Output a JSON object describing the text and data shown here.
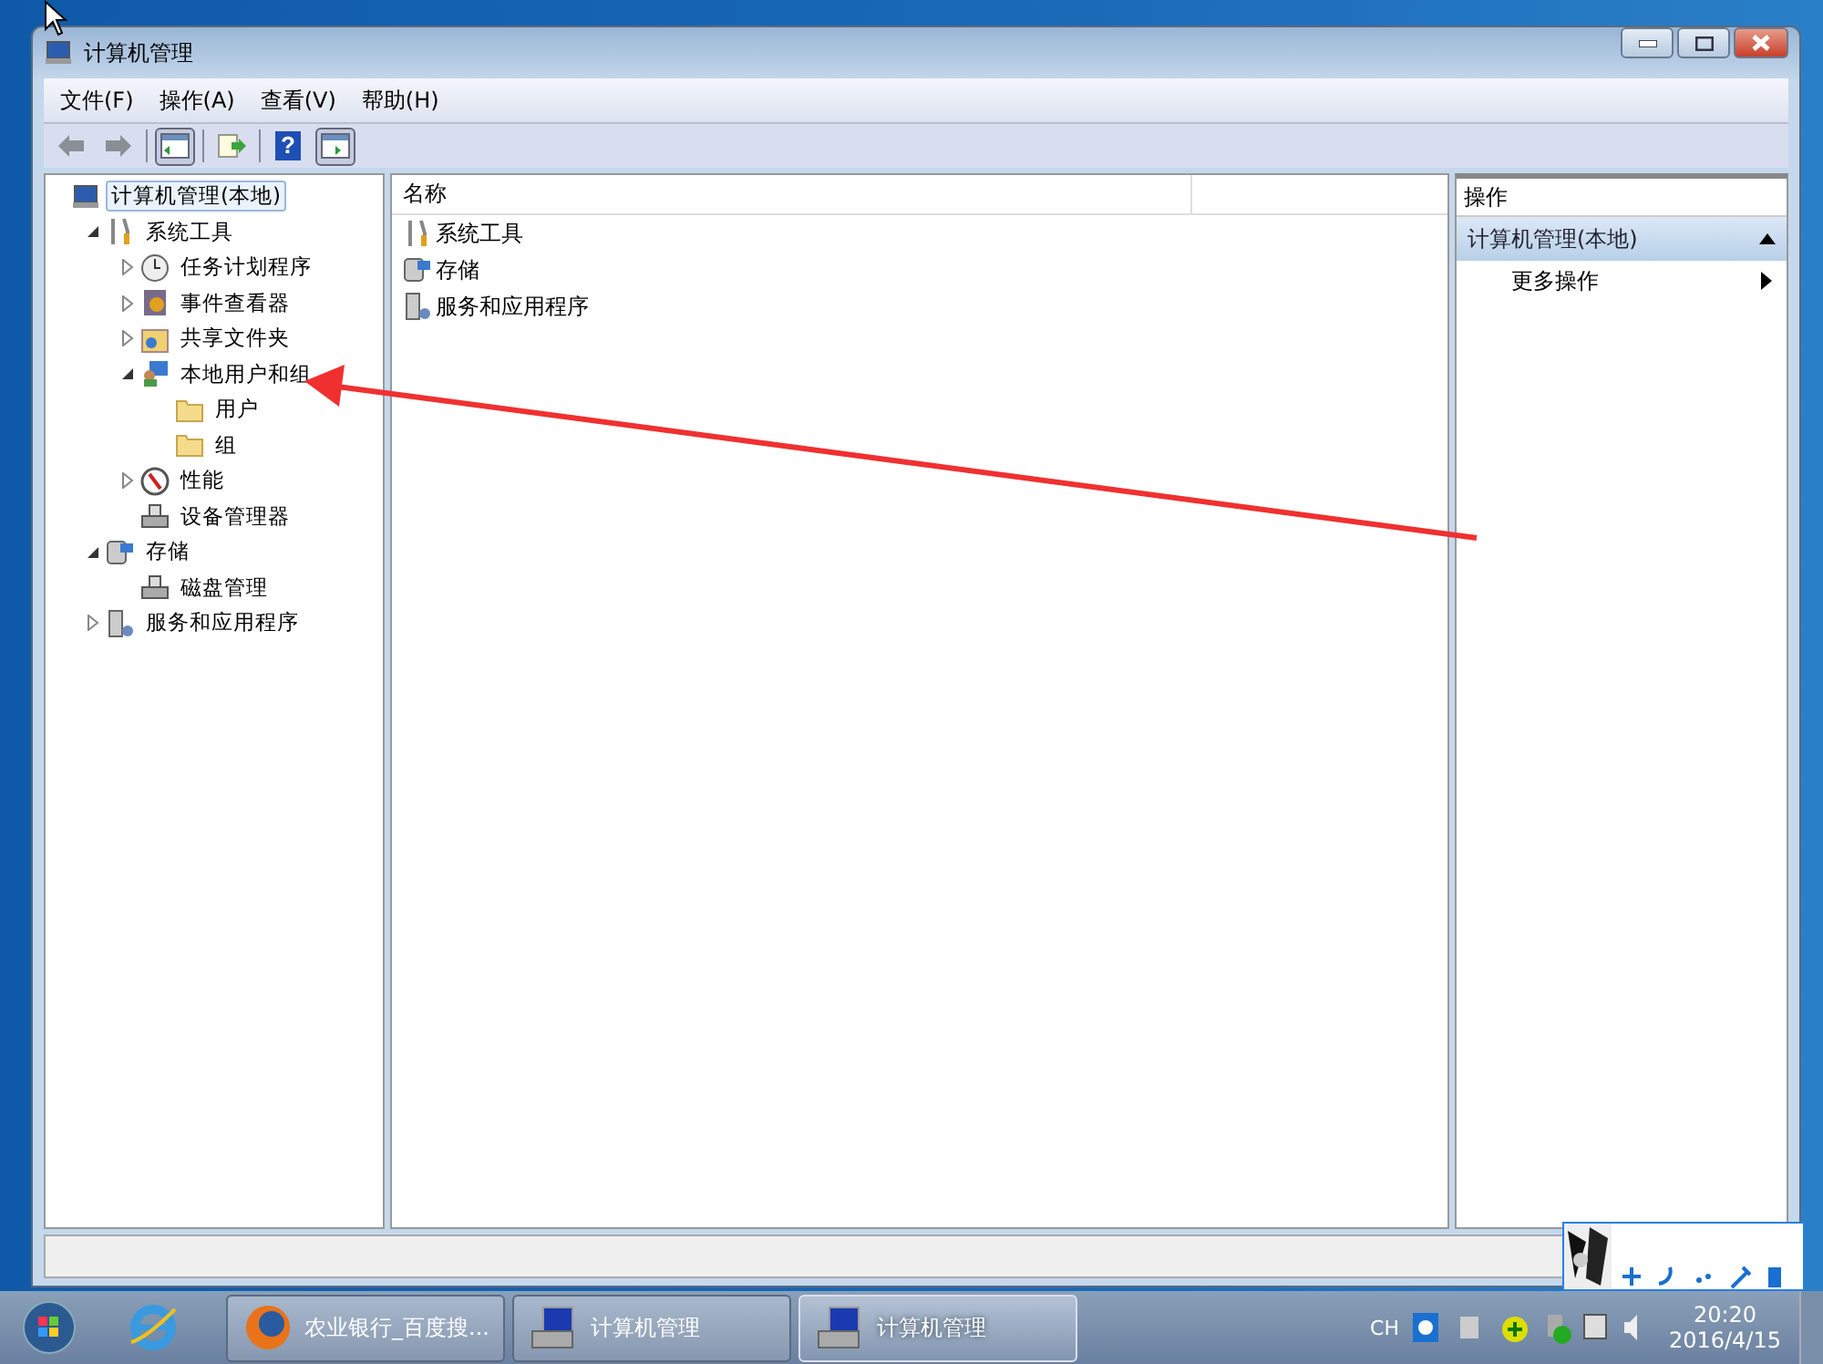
{
  "window": {
    "title": "计算机管理"
  },
  "menu": [
    "文件(F)",
    "操作(A)",
    "查看(V)",
    "帮助(H)"
  ],
  "toolbar": [
    {
      "kind": "back",
      "pressed": false
    },
    {
      "kind": "forward",
      "pressed": false
    },
    {
      "kind": "sep"
    },
    {
      "kind": "tree",
      "pressed": true
    },
    {
      "kind": "sep"
    },
    {
      "kind": "export",
      "pressed": false
    },
    {
      "kind": "sep"
    },
    {
      "kind": "help",
      "label": "?",
      "pressed": false
    },
    {
      "kind": "actionpane",
      "pressed": true
    }
  ],
  "tree": [
    {
      "label": "计算机管理(本地)",
      "kind": "computer",
      "selected": true,
      "children": [
        {
          "label": "系统工具",
          "kind": "tools",
          "selected": false,
          "expanded": true,
          "children": [
            {
              "label": "任务计划程序",
              "kind": "clock",
              "selected": false,
              "expanded": false
            },
            {
              "label": "事件查看器",
              "kind": "event",
              "selected": false,
              "expanded": false
            },
            {
              "label": "共享文件夹",
              "kind": "share",
              "selected": false,
              "expanded": false
            },
            {
              "label": "本地用户和组",
              "kind": "users",
              "selected": false,
              "expanded": true,
              "children": [
                {
                  "label": "用户",
                  "kind": "folder",
                  "selected": false
                },
                {
                  "label": "组",
                  "kind": "folder",
                  "selected": false
                }
              ]
            },
            {
              "label": "性能",
              "kind": "perf",
              "selected": false,
              "expanded": false
            },
            {
              "label": "设备管理器",
              "kind": "device",
              "selected": false
            }
          ]
        },
        {
          "label": "存储",
          "kind": "storage",
          "selected": false,
          "expanded": true,
          "children": [
            {
              "label": "磁盘管理",
              "kind": "device",
              "selected": false
            }
          ]
        },
        {
          "label": "服务和应用程序",
          "kind": "services",
          "selected": false,
          "expanded": false
        }
      ]
    }
  ],
  "list": {
    "columns": [
      "名称"
    ],
    "rows": [
      {
        "label": "系统工具",
        "kind": "tools"
      },
      {
        "label": "存储",
        "kind": "storage"
      },
      {
        "label": "服务和应用程序",
        "kind": "services"
      }
    ]
  },
  "actions": {
    "title": "操作",
    "section": "计算机管理(本地)",
    "items": [
      "更多操作"
    ]
  },
  "taskbar": {
    "buttons": [
      {
        "label": "农业银行_百度搜...",
        "kind": "firefox",
        "selected": false
      },
      {
        "label": "计算机管理",
        "kind": "computer",
        "selected": false
      },
      {
        "label": "计算机管理",
        "kind": "computer",
        "selected": true
      }
    ],
    "language": "CH",
    "time": "20:20",
    "date": "2016/4/15"
  }
}
